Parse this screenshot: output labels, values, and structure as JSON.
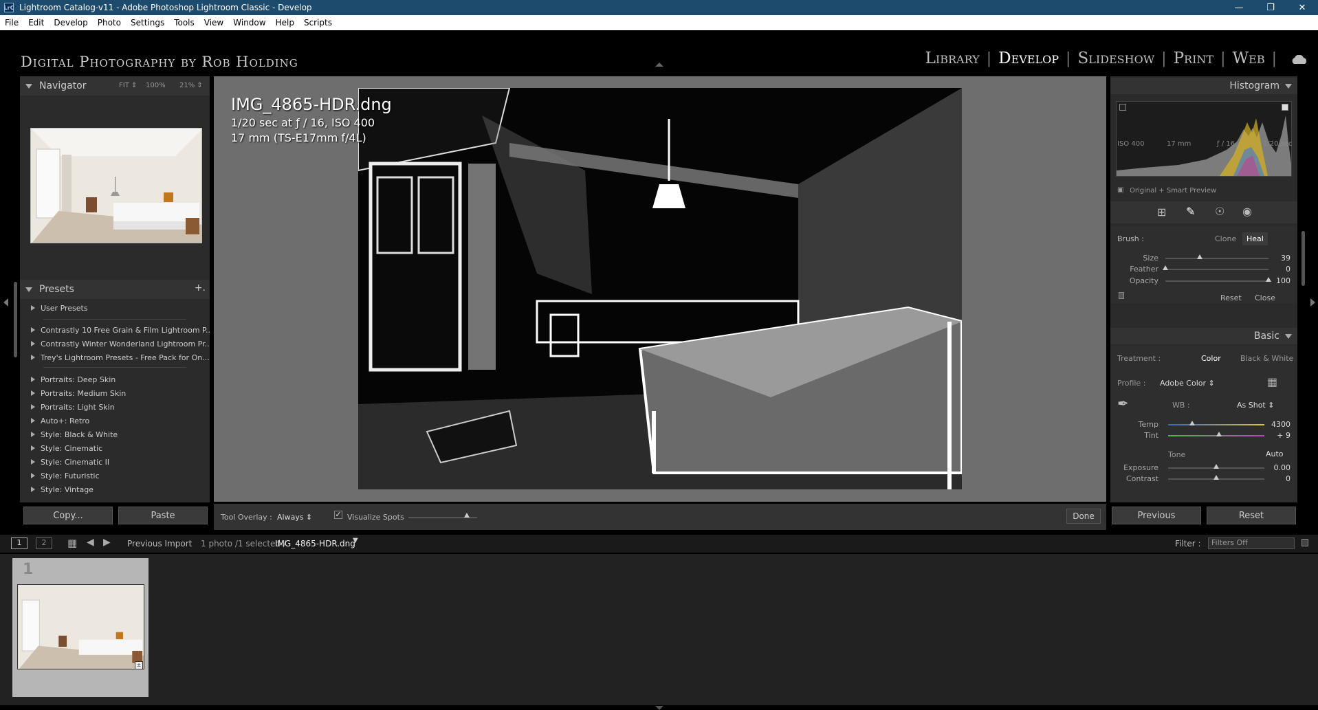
{
  "window": {
    "title": "Lightroom Catalog-v11 - Adobe Photoshop Lightroom Classic - Develop",
    "app_badge": "LrC"
  },
  "menu": [
    "File",
    "Edit",
    "Develop",
    "Photo",
    "Settings",
    "Tools",
    "View",
    "Window",
    "Help",
    "Scripts"
  ],
  "identity_plate": "Digital Photography by Rob Holding",
  "modules": [
    "Library",
    "Develop",
    "Slideshow",
    "Print",
    "Web"
  ],
  "active_module": "Develop",
  "navigator": {
    "title": "Navigator",
    "zoom_options": [
      "FIT ⇕",
      "100%",
      "21% ⇕"
    ]
  },
  "presets": {
    "title": "Presets",
    "add_symbol": "+.",
    "groups": [
      [
        "User Presets"
      ],
      [
        "Contrastly 10 Free Grain & Film Lightroom P...",
        "Contrastly Winter Wonderland Lightroom Pr...",
        "Trey's Lightroom Presets - Free Pack for On..."
      ],
      [
        "Portraits: Deep Skin",
        "Portraits: Medium Skin",
        "Portraits: Light Skin",
        "Auto+: Retro",
        "Style: Black & White",
        "Style: Cinematic",
        "Style: Cinematic II",
        "Style: Futuristic",
        "Style: Vintage"
      ]
    ]
  },
  "left_buttons": {
    "copy": "Copy...",
    "paste": "Paste"
  },
  "image_info": {
    "filename": "IMG_4865-HDR.dng",
    "exposure": "1/20 sec at ƒ / 16, ISO 400",
    "lens": "17 mm (TS-E17mm f/4L)"
  },
  "toolbar": {
    "tool_overlay_label": "Tool Overlay :",
    "tool_overlay_value": "Always ⇕",
    "visualize_spots": "Visualize Spots",
    "visualize_checked": true,
    "visualize_level": 0.85,
    "done": "Done"
  },
  "histogram": {
    "title": "Histogram",
    "iso": "ISO 400",
    "focal": "17 mm",
    "aperture": "ƒ / 16",
    "shutter": "1/20 sec",
    "preview": "Original + Smart Preview"
  },
  "spot_removal": {
    "brush_label": "Brush :",
    "clone": "Clone",
    "heal": "Heal",
    "active_brush": "Heal",
    "sliders": [
      {
        "label": "Size",
        "value": "39",
        "pos": 0.33
      },
      {
        "label": "Feather",
        "value": "0",
        "pos": 0.0
      },
      {
        "label": "Opacity",
        "value": "100",
        "pos": 1.0
      }
    ],
    "reset": "Reset",
    "close": "Close"
  },
  "basic": {
    "title": "Basic",
    "treatment_label": "Treatment :",
    "treatment_color": "Color",
    "treatment_bw": "Black & White",
    "profile_label": "Profile :",
    "profile_value": "Adobe Color ⇕",
    "wb_label": "WB :",
    "wb_value": "As Shot ⇕",
    "temp": {
      "label": "Temp",
      "value": "4300",
      "pos": 0.25
    },
    "tint": {
      "label": "Tint",
      "value": "+ 9",
      "pos": 0.53
    },
    "tone_label": "Tone",
    "auto": "Auto",
    "exposure": {
      "label": "Exposure",
      "value": "0.00",
      "pos": 0.5
    },
    "contrast": {
      "label": "Contrast",
      "value": "0",
      "pos": 0.5
    }
  },
  "right_buttons": {
    "previous": "Previous",
    "reset": "Reset"
  },
  "filmstrip_bar": {
    "screen1": "1",
    "screen2": "2",
    "source": "Previous Import",
    "count": "1 photo /1 selected /",
    "selected_file": "IMG_4865-HDR.dng",
    "filter_label": "Filter :",
    "filter_value": "Filters Off"
  },
  "filmstrip": {
    "cell_index": "1"
  },
  "colors": {
    "accent_title": "#1d4b6e",
    "panel": "#2b2b2b",
    "canvas": "#6e6e6e"
  }
}
